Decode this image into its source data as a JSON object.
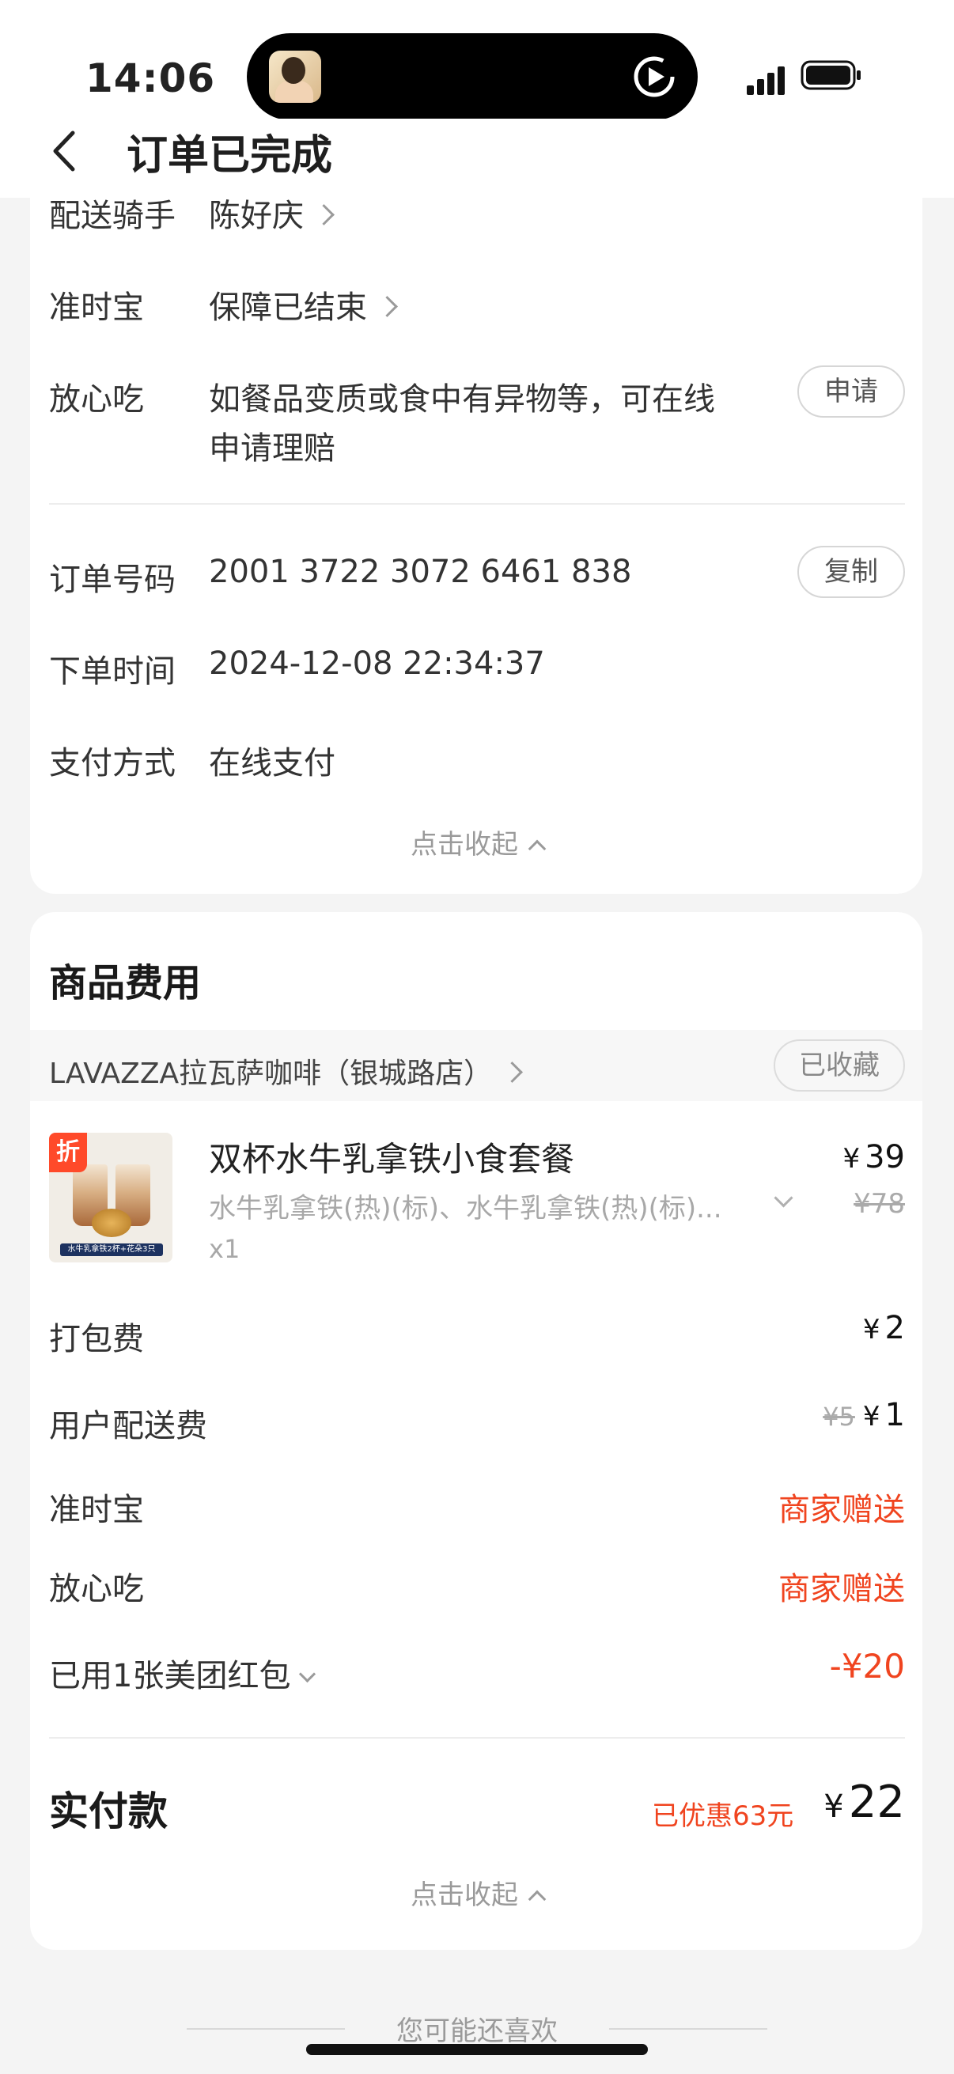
{
  "status_bar": {
    "time": "14:06"
  },
  "header": {
    "title": "订单已完成"
  },
  "delivery_info": {
    "rider": {
      "label": "配送骑手",
      "value": "陈好庆"
    },
    "ontime": {
      "label": "准时宝",
      "value": "保障已结束"
    },
    "safe_eat": {
      "label": "放心吃",
      "line1": "如餐品变质或食中有异物等，可在线",
      "line2": "申请理赔",
      "button": "申请"
    },
    "order_no": {
      "label": "订单号码",
      "value": "2001 3722 3072 6461 838",
      "button": "复制"
    },
    "order_time": {
      "label": "下单时间",
      "value": "2024-12-08 22:34:37"
    },
    "payment": {
      "label": "支付方式",
      "value": "在线支付"
    },
    "collapse": "点击收起"
  },
  "goods": {
    "title": "商品费用",
    "store": {
      "name": "LAVAZZA拉瓦萨咖啡（银城路店）",
      "fav_label": "已收藏"
    },
    "item": {
      "badge": "折",
      "image_band": "水牛乳拿铁2杯+花朵3只",
      "name": "双杯水牛乳拿铁小食套餐",
      "spec": "水牛乳拿铁(热)(标)、水牛乳拿铁(热)(标)...",
      "qty": "x1",
      "price": "39",
      "orig_price": "¥78"
    },
    "fees": {
      "packing": {
        "label": "打包费",
        "value": "2"
      },
      "delivery": {
        "label": "用户配送费",
        "orig": "¥5",
        "value": "1"
      },
      "ontime": {
        "label": "准时宝",
        "value": "商家赠送"
      },
      "safe_eat": {
        "label": "放心吃",
        "value": "商家赠送"
      },
      "redpacket": {
        "label": "已用1张美团红包",
        "value": "-¥20"
      }
    },
    "total": {
      "label": "实付款",
      "saved": "已优惠63元",
      "value": "22"
    },
    "currency": "¥",
    "collapse": "点击收起"
  },
  "recommend": {
    "title": "您可能还喜欢"
  },
  "colors": {
    "accent_red": "#f0441f",
    "badge_red": "#ff4a2a"
  }
}
